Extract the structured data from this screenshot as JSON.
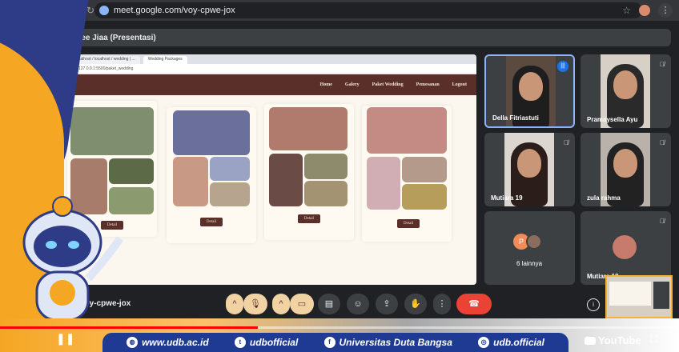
{
  "browser": {
    "url": "meet.google.com/voy-cpwe-jox",
    "back": "←",
    "forward": "→",
    "reload": "↻",
    "star": "☆",
    "menu": "⋮"
  },
  "presenter": {
    "label": "Abee Jiaa (Presentasi)"
  },
  "shared_window": {
    "tabs": [
      {
        "label": "localhost / localhost / wedding | ..."
      },
      {
        "label": "Wedding Packages"
      }
    ],
    "address": "127.0.0.1:5500/paket_wedding",
    "nav": [
      "Home",
      "Galery",
      "Paket Wedding",
      "Pemesanan",
      "Logout"
    ],
    "detail_label": "Detail"
  },
  "participants": [
    {
      "name": "Della Fitriastuti",
      "speaking": true
    },
    {
      "name": "Pramaysella Ayu"
    },
    {
      "name": "Mutiara 19"
    },
    {
      "name": "zula rahma"
    },
    {
      "name": "6 lainnya",
      "initial": "P"
    },
    {
      "name": "Mutiara 19"
    }
  ],
  "toolbar": {
    "meeting_code": "voy-cpwe-jox",
    "chevron": "^",
    "mic_icon": "mic-off",
    "cam_icon": "camera-off",
    "info": "i"
  },
  "footer": {
    "website": "www.udb.ac.id",
    "twitter": "udbofficial",
    "facebook": "Universitas Duta Bangsa",
    "instagram": "udb.official",
    "youtube": "YouTube"
  },
  "progress": {
    "fraction": 0.38
  },
  "colors": {
    "meet_bg": "#202124",
    "tile_bg": "#3c4043",
    "speaking_border": "#8ab4f8",
    "end_call": "#ea4335",
    "site_brown": "#5a2f2a",
    "udb_blue": "#1f3a93",
    "udb_orange": "#f5a623"
  }
}
